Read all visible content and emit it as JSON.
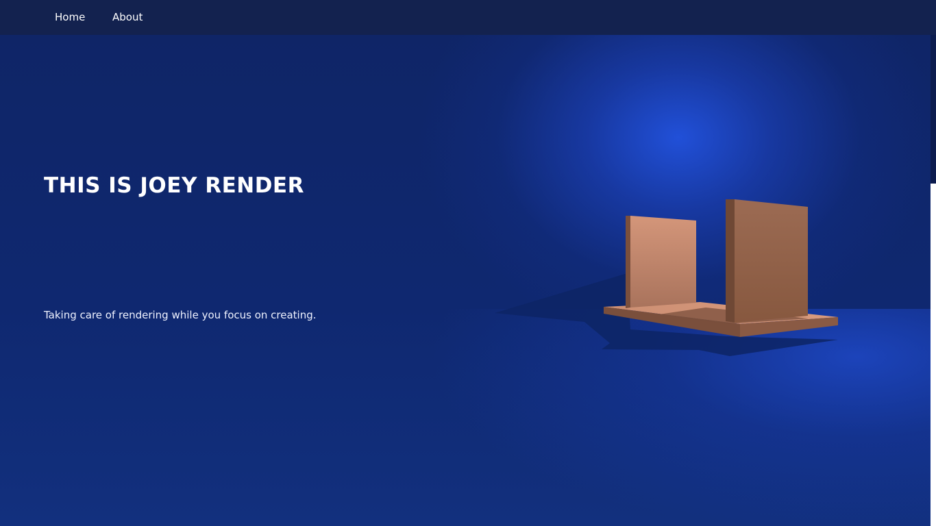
{
  "nav": {
    "home_label": "Home",
    "about_label": "About"
  },
  "hero": {
    "title": "THIS IS JOEY RENDER",
    "subtitle": "Taking care of rendering while you focus on creating."
  },
  "colors": {
    "navbar": "#13224f",
    "background": "#0e2466",
    "spotlight": "#2252de",
    "model_light": "#d4967a",
    "model_dark": "#7a4f3c"
  },
  "render": {
    "icon": "3d-render-model-icon"
  }
}
